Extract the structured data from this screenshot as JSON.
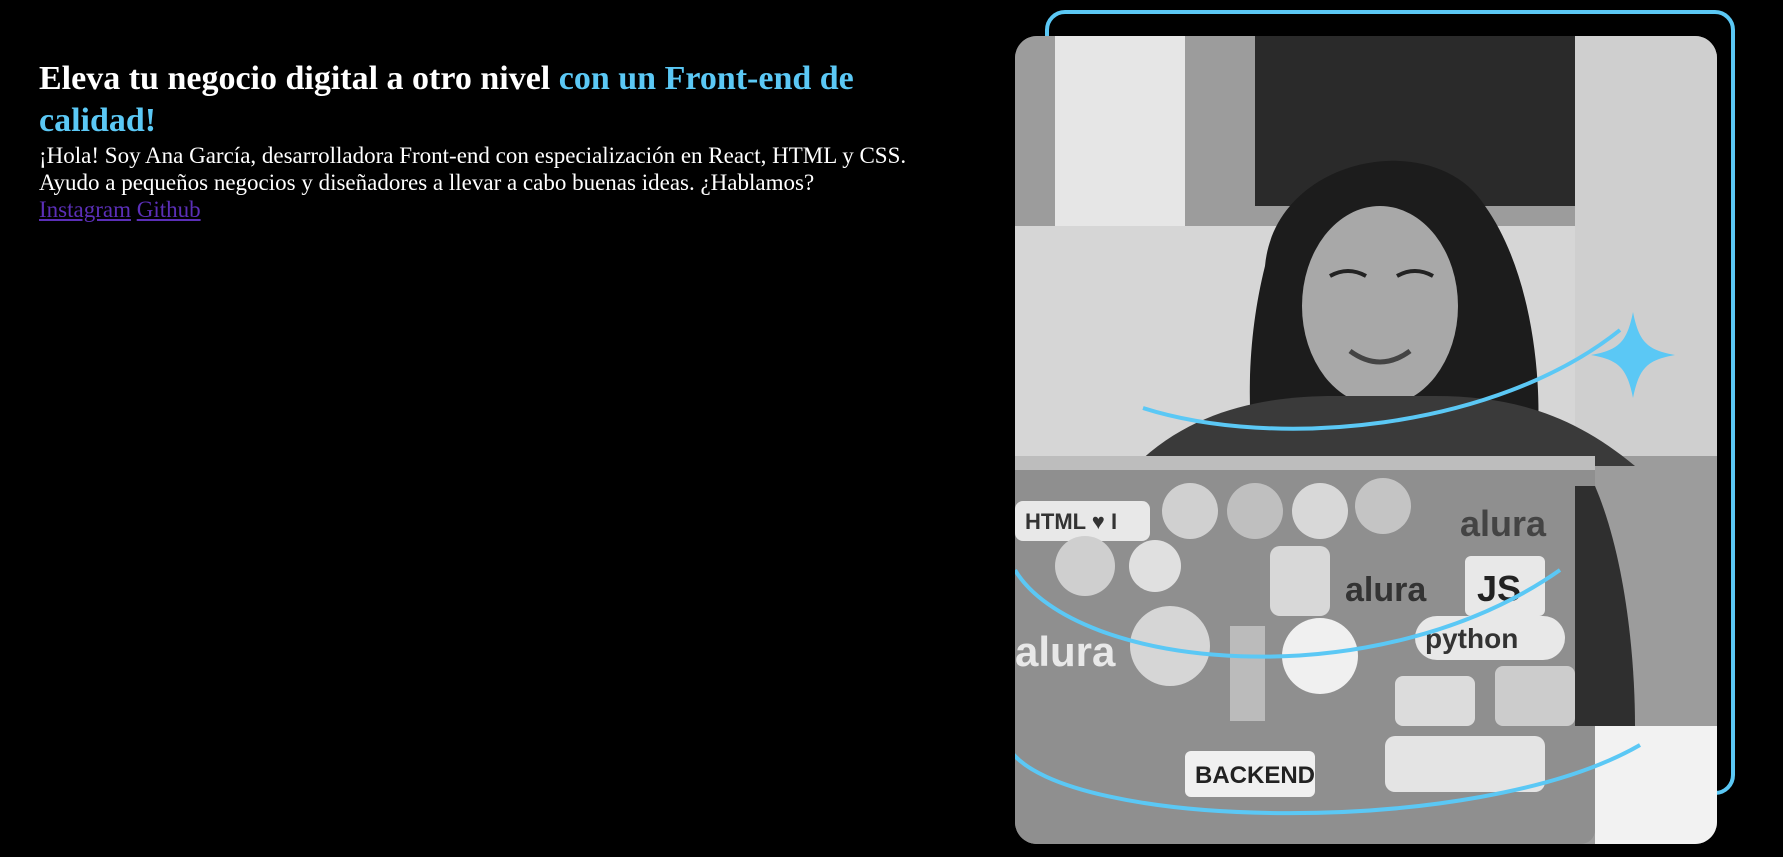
{
  "hero": {
    "title_plain": "Eleva tu negocio digital a otro nivel ",
    "title_accent": "con un Front-end de calidad!",
    "description_line1": "¡Hola! Soy Ana García, desarrolladora Front-end con especialización en React, HTML y CSS.",
    "description_line2": "Ayudo a pequeños negocios y diseñadores a llevar a cabo buenas ideas. ¿Hablamos?"
  },
  "links": {
    "instagram": "Instagram",
    "github": "Github"
  },
  "photo": {
    "stickers": [
      "HTML ♥ I",
      "alura",
      "JS",
      "alura",
      "python",
      "alura",
      "BACKEND"
    ]
  },
  "colors": {
    "background": "#000000",
    "accent": "#5bc8f5",
    "link": "#5b2fb8",
    "text": "#ffffff"
  }
}
